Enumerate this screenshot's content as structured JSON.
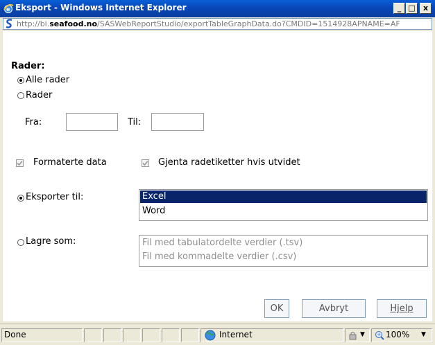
{
  "window": {
    "title": "Eksport - Windows Internet Explorer",
    "controls": {
      "minimize": "_",
      "maximize": "□",
      "close": "x"
    }
  },
  "address": {
    "url_prefix": "http://bi.",
    "url_domain": "seafood.no",
    "url_rest": "/SASWebReportStudio/exportTableGraphData.do?CMDID=1514928APNAME=AF"
  },
  "rows": {
    "heading": "Rader:",
    "all_rows_label": "Alle rader",
    "rows_label": "Rader",
    "from_label": "Fra:",
    "to_label": "Til:",
    "from_value": "",
    "to_value": ""
  },
  "options": {
    "formatted_label": "Formaterte data",
    "repeat_label": "Gjenta radetiketter hvis utvidet"
  },
  "export_to": {
    "label": "Eksporter til:",
    "items": [
      "Excel",
      "Word"
    ],
    "selected": "Excel"
  },
  "save_as": {
    "label": "Lagre som:",
    "items": [
      "Fil med tabulatordelte verdier (.tsv)",
      "Fil med kommadelte verdier (.csv)"
    ]
  },
  "buttons": {
    "ok": "OK",
    "cancel": "Avbryt",
    "help": "Hjelp"
  },
  "status": {
    "text": "Done",
    "zone": "Internet",
    "zoom": "100%"
  },
  "colors": {
    "titlebar": "#0846b8",
    "selection": "#0a246a",
    "background": "#ffffff"
  }
}
